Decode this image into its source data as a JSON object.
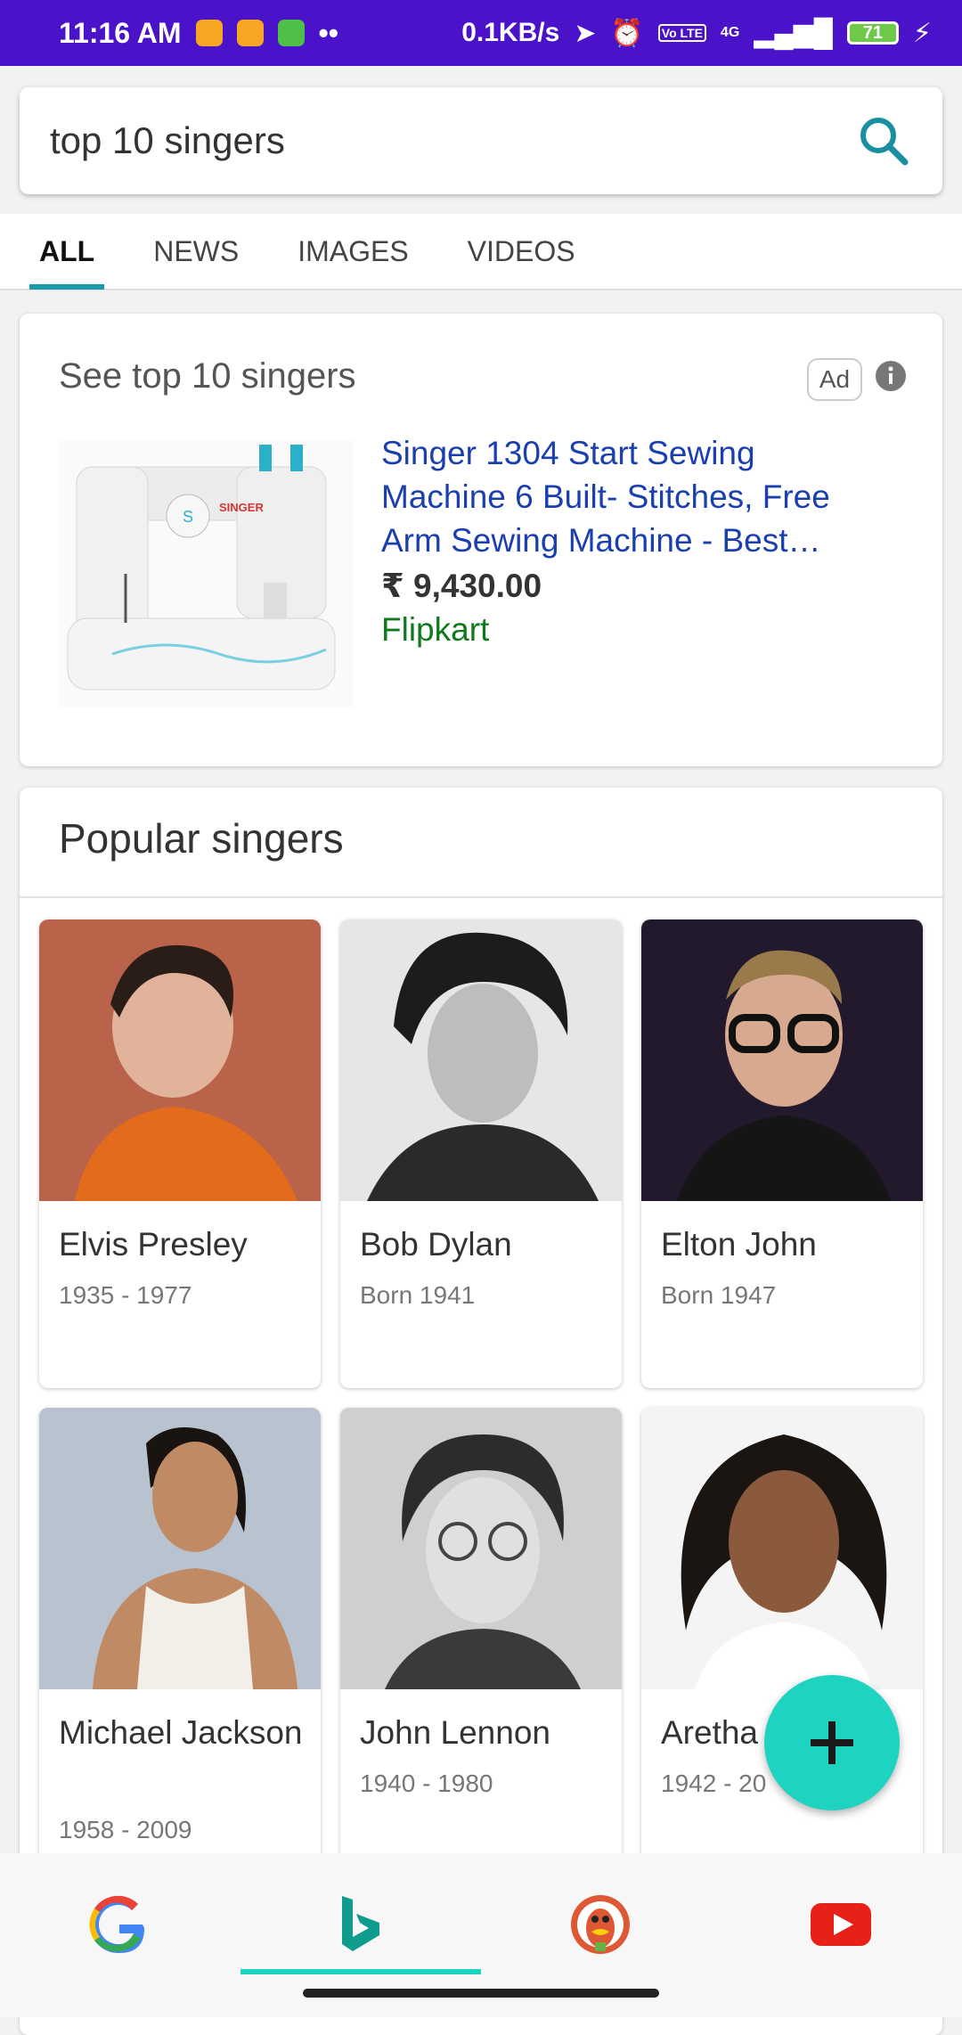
{
  "status_bar": {
    "time": "11:16 AM",
    "network_speed": "0.1KB/s",
    "network_type": "4G",
    "battery": "71",
    "volte": "Vo LTE"
  },
  "search": {
    "query": "top 10 singers"
  },
  "tabs": [
    {
      "label": "ALL",
      "active": true
    },
    {
      "label": "NEWS",
      "active": false
    },
    {
      "label": "IMAGES",
      "active": false
    },
    {
      "label": "VIDEOS",
      "active": false
    }
  ],
  "ad": {
    "heading": "See top 10 singers",
    "badge": "Ad",
    "product_title": "Singer 1304 Start Sewing Machine 6 Built- Stitches, Free Arm Sewing Machine - Best…",
    "price": "₹ 9,430.00",
    "store": "Flipkart",
    "product_brand": "SINGER"
  },
  "popular": {
    "heading": "Popular singers",
    "singers": [
      {
        "name": "Elvis Presley",
        "years": "1935 - 1977"
      },
      {
        "name": "Bob Dylan",
        "years": "Born 1941"
      },
      {
        "name": "Elton John",
        "years": "Born 1947"
      },
      {
        "name": "Michael Jackson",
        "years": "1958 - 2009"
      },
      {
        "name": "John Lennon",
        "years": "1940 - 1980"
      },
      {
        "name": "Aretha",
        "years": "1942 - 20"
      }
    ]
  },
  "bottom_nav": [
    {
      "icon": "google-icon",
      "active": false
    },
    {
      "icon": "bing-icon",
      "active": true
    },
    {
      "icon": "duckduckgo-icon",
      "active": false
    },
    {
      "icon": "youtube-icon",
      "active": false
    }
  ],
  "colors": {
    "status_bar": "#4a12c9",
    "accent": "#1ed3c0",
    "tab_indicator": "#1a9aa8",
    "link": "#1a3fae",
    "store": "#0f7a1c"
  }
}
